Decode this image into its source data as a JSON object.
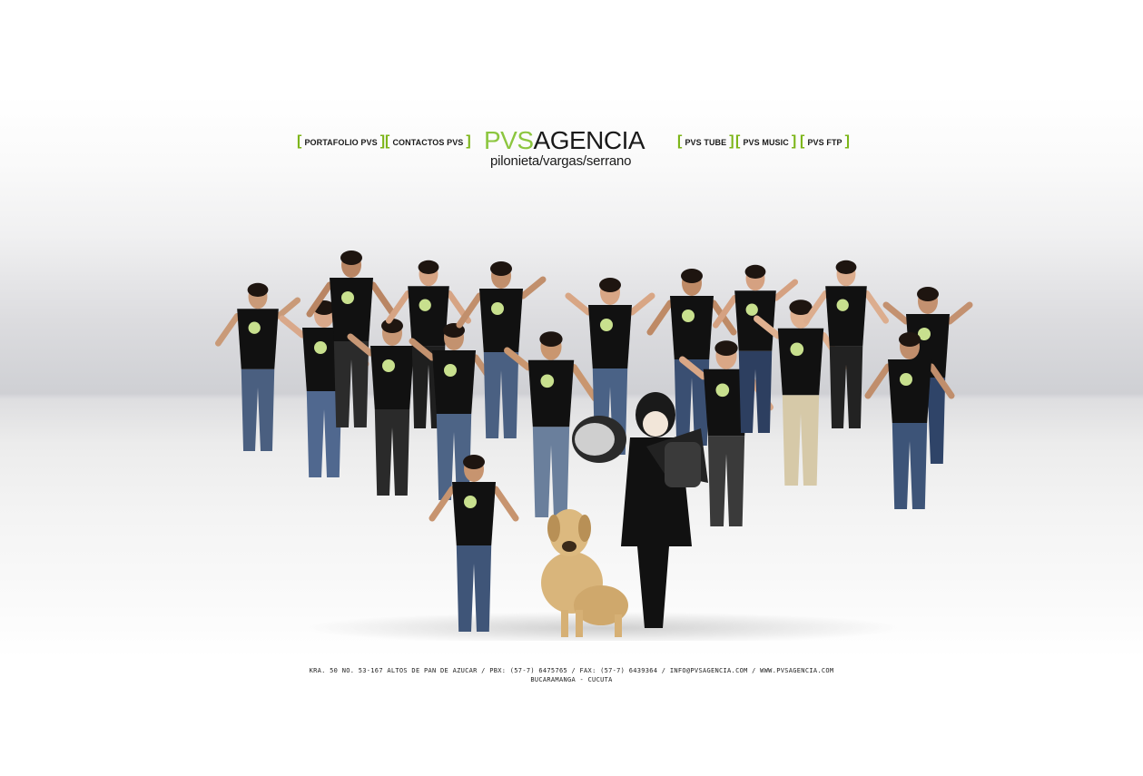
{
  "nav": {
    "left": [
      {
        "label": "PORTAFOLIO PVS"
      },
      {
        "label": "CONTACTOS PVS"
      }
    ],
    "right": [
      {
        "label": "PVS TUBE"
      },
      {
        "label": "PVS MUSIC"
      },
      {
        "label": "PVS FTP"
      }
    ],
    "bracket_open": "[",
    "bracket_close": "]"
  },
  "logo": {
    "part1": "PVS",
    "part2": "AGENCIA",
    "subtitle": "pilonieta/vargas/serrano"
  },
  "colors": {
    "accent_green": "#7cb518",
    "logo_green": "#8cc63f",
    "text_dark": "#1a1a1a"
  },
  "footer": {
    "address": "KRA. 50 NO. 53-167 ALTOS DE PAN DE AZUCAR / PBX: (57-7) 6475765 / FAX: (57-7) 6439364 / INFO@PVSAGENCIA.COM / WWW.PVSAGENCIA.COM",
    "cities": "BUCARAMANGA - CUCUTA"
  }
}
